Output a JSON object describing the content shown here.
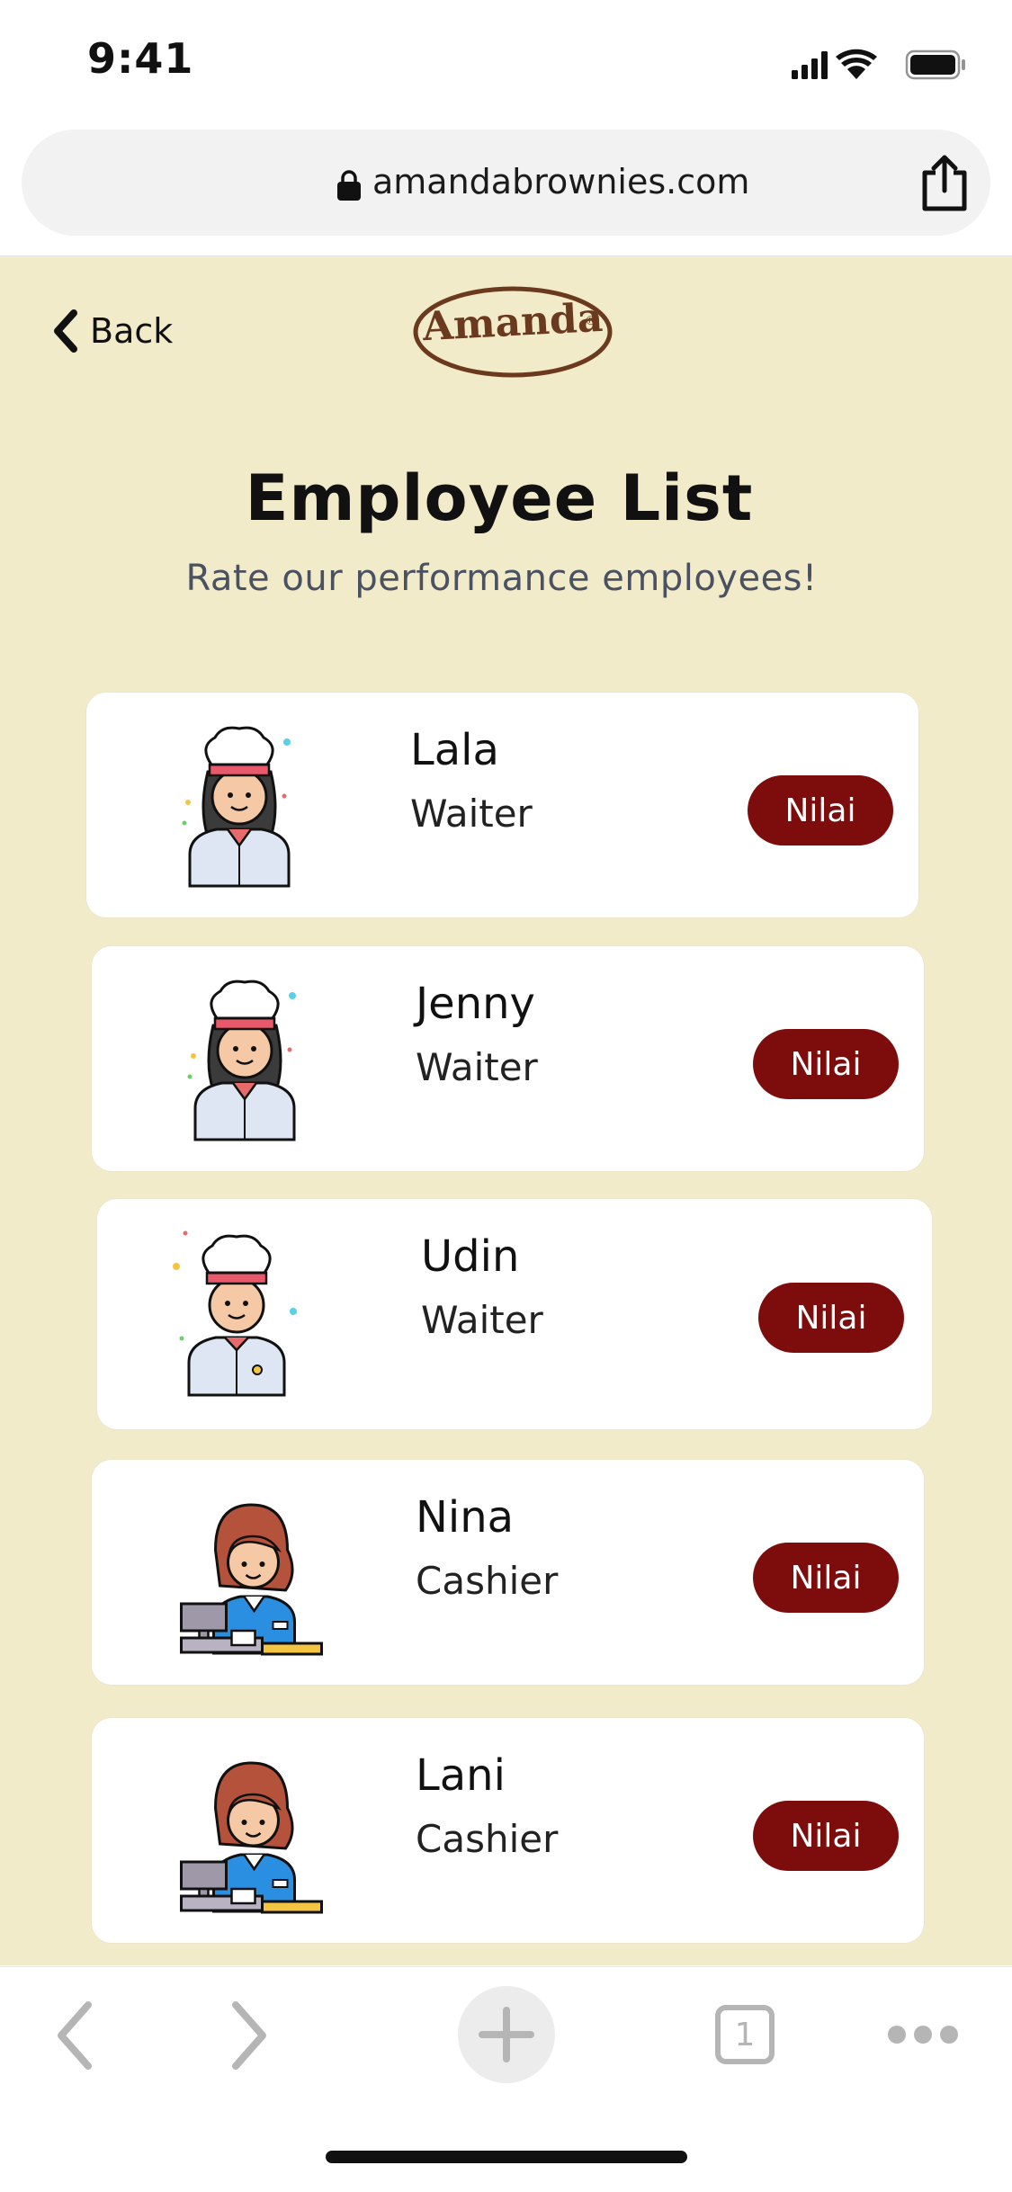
{
  "status_bar": {
    "time": "9:41"
  },
  "browser": {
    "url": "amandabrownies.com",
    "tab_count": "1"
  },
  "header": {
    "back_label": "Back",
    "logo_text": "Amanda",
    "logo_mark": "®"
  },
  "main": {
    "title": "Employee List",
    "subtitle": "Rate our performance employees!"
  },
  "employees": [
    {
      "name": "Lala",
      "role": "Waiter",
      "button_label": "Nilai",
      "avatar": "chef-woman-icon"
    },
    {
      "name": "Jenny",
      "role": "Waiter",
      "button_label": "Nilai",
      "avatar": "chef-woman-icon"
    },
    {
      "name": "Udin",
      "role": "Waiter",
      "button_label": "Nilai",
      "avatar": "chef-man-icon"
    },
    {
      "name": "Nina",
      "role": "Cashier",
      "button_label": "Nilai",
      "avatar": "cashier-woman-icon"
    },
    {
      "name": "Lani",
      "role": "Cashier",
      "button_label": "Nilai",
      "avatar": "cashier-woman-icon"
    }
  ],
  "colors": {
    "page_background": "#f2ebca",
    "button": "#7d0c0c",
    "logo": "#6b3a1e",
    "subtitle": "#4a5262"
  }
}
